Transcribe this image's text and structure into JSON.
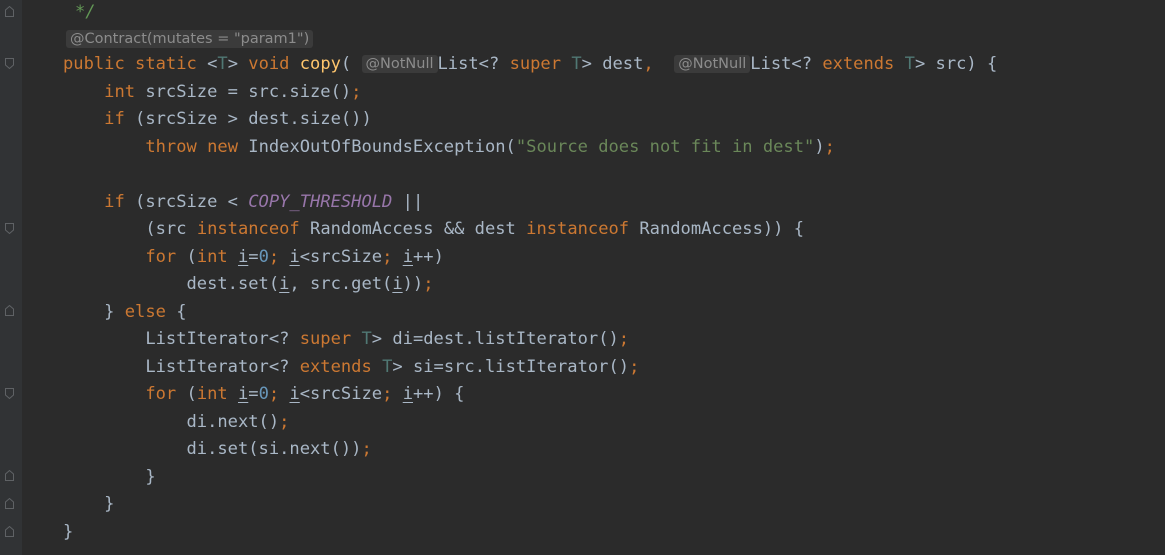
{
  "colors": {
    "background": "#2b2b2b",
    "gutter": "#313335",
    "default_text": "#a9b7c6",
    "keyword": "#cc7832",
    "method": "#ffc66d",
    "string": "#6a8759",
    "number": "#6897bb",
    "constant": "#9876aa",
    "type_param": "#507874",
    "comment": "#629755",
    "hint_text": "#8c8c8c",
    "hint_bg": "#3b3b3b"
  },
  "code": {
    "comment_end": "*/",
    "contract_hint": "@Contract(mutates = \"param1\")",
    "line_signature": {
      "kw_public": "public",
      "kw_static": "static",
      "lt": "<",
      "tparam": "T",
      "gt": ">",
      "kw_void": "void",
      "name": "copy",
      "open": "(",
      "hint1": "@NotNull",
      "list1": "List<?",
      "kw_super": "super",
      "tparam2": "T",
      "after_super": "> dest",
      "comma": ",",
      "hint2": "@NotNull",
      "list2": "List<?",
      "kw_extends": "extends",
      "tparam3": "T",
      "after_extends": "> src) {"
    },
    "line_int": {
      "kw": "int",
      "rest": " srcSize = src.size()",
      "semi": ";"
    },
    "line_if1": {
      "kw": "if",
      "rest": " (srcSize > dest.size())"
    },
    "line_throw": {
      "kw_throw": "throw",
      "kw_new": "new",
      "cls": " IndexOutOfBoundsException(",
      "str": "\"Source does not fit in dest\"",
      "close": ")",
      "semi": ";"
    },
    "line_if2": {
      "kw": "if",
      "pre": " (srcSize < ",
      "const": "COPY_THRESHOLD",
      "post": " ||"
    },
    "line_instanceof": {
      "pre": "(src ",
      "kw1": "instanceof",
      "mid": " RandomAccess && dest ",
      "kw2": "instanceof",
      "post": " RandomAccess)) {"
    },
    "line_for1": {
      "kw_for": "for",
      "open": " (",
      "kw_int": "int",
      "sp": " ",
      "i1": "i",
      "eq": "=",
      "zero": "0",
      "semi1": ";",
      "sp2": " ",
      "i2": "i",
      "cmp": "<srcSize",
      "semi2": ";",
      "sp3": " ",
      "i3": "i",
      "inc": "++)"
    },
    "line_set1": {
      "pre": "dest.set(",
      "i1": "i",
      "mid": ", src.get(",
      "i2": "i",
      "post": "))",
      "semi": ";"
    },
    "line_else": {
      "pre": "} ",
      "kw": "else",
      "post": " {"
    },
    "line_di": {
      "pre": "ListIterator<? ",
      "kw": "super",
      "sp": " ",
      "tp": "T",
      "post": "> di=dest.listIterator()",
      "semi": ";"
    },
    "line_si": {
      "pre": "ListIterator<? ",
      "kw": "extends",
      "sp": " ",
      "tp": "T",
      "post": "> si=src.listIterator()",
      "semi": ";"
    },
    "line_for2": {
      "kw_for": "for",
      "open": " (",
      "kw_int": "int",
      "sp": " ",
      "i1": "i",
      "eq": "=",
      "zero": "0",
      "semi1": ";",
      "sp2": " ",
      "i2": "i",
      "cmp": "<srcSize",
      "semi2": ";",
      "sp3": " ",
      "i3": "i",
      "inc": "++) {"
    },
    "line_next": {
      "pre": "di.next()",
      "semi": ";"
    },
    "line_set2": {
      "pre": "di.set(si.next())",
      "semi": ";"
    },
    "close_for2": "}",
    "close_else": "}",
    "close_method": "}"
  }
}
